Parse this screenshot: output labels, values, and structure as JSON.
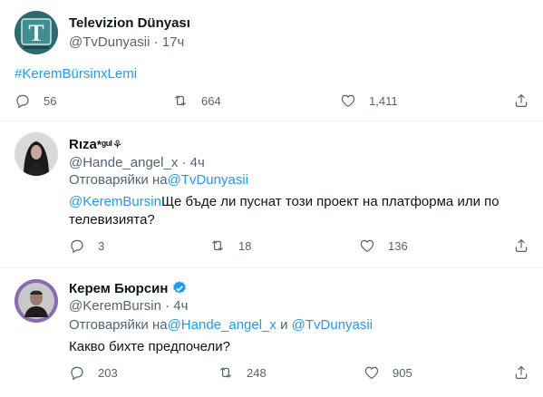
{
  "tweet1": {
    "display_name": "Televizion Dünyası",
    "handle": "@TvDunyasii",
    "time": "17ч",
    "hashtag": "#KeremBürsinxLemi",
    "replies": "56",
    "retweets": "664",
    "likes": "1,411"
  },
  "tweet2": {
    "display_name": "Rıza",
    "name_suffix": "*ᵍᵘˡ⚘",
    "handle": "@Hande_angel_x",
    "time": "4ч",
    "reply_prefix": "Отговаряйки на",
    "reply_to": "@TvDunyasii",
    "mention": "@KeremBursin",
    "text_line1": "Ще бъде ли пуснат този проект на платформа или по",
    "text_line2": "телевизията?",
    "replies": "3",
    "retweets": "18",
    "likes": "136"
  },
  "tweet3": {
    "display_name": "Керем Бюрсин",
    "handle": "@KeremBursin",
    "time": "4ч",
    "reply_prefix": "Отговаряйки на",
    "reply_to1": "@Hande_angel_x",
    "reply_and": " и ",
    "reply_to2": "@TvDunyasii",
    "text_line1": "Какво бихте предпочели?",
    "replies": "203",
    "retweets": "248",
    "likes": "905"
  },
  "separator": " · ",
  "colors": {
    "link": "#1d9bf0",
    "muted": "#536471",
    "verified": "#1d9bf0",
    "text": "#0f1419"
  }
}
